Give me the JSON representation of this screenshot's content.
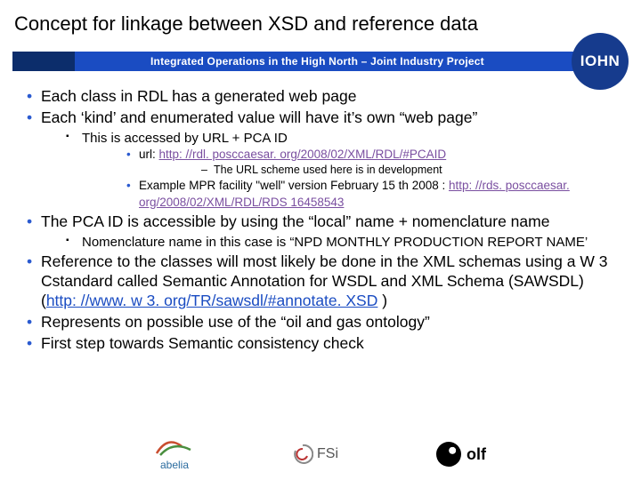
{
  "title": "Concept for linkage between XSD and reference data",
  "banner": {
    "text": "Integrated Operations in the High North – Joint Industry Project",
    "logo": "IOHN"
  },
  "bullets": {
    "b1": "Each class in RDL has a generated web page",
    "b2": "Each ‘kind’ and enumerated value will have it’s own “web page”",
    "b2_1": "This is accessed by URL + PCA ID",
    "b2_1_1_pre": "url: ",
    "b2_1_1_link": "http: //rdl. posccaesar. org/2008/02/XML/RDL/#PCAID",
    "b2_1_1_1": "The URL scheme used here is in development",
    "b2_1_2_pre": "Example MPR facility \"well\" version February 15 th 2008 : ",
    "b2_1_2_link": "http: //rds. posccaesar. org/2008/02/XML/RDL/RDS 16458543",
    "b3": "The PCA ID is accessible by using the “local” name + nomenclature name",
    "b3_1": "Nomenclature name in this case is “NPD MONTHLY PRODUCTION REPORT NAME’",
    "b4_pre": "Reference to the classes will most likely be done in the XML schemas using a W 3 Cstandard called Semantic Annotation for WSDL and XML Schema (SAWSDL) (",
    "b4_link": "http: //www. w 3. org/TR/sawsdl/#annotate. XSD",
    "b4_post": " )",
    "b5": "Represents on possible use of the “oil and gas ontology”",
    "b6": "First step towards Semantic consistency check"
  },
  "logos": {
    "abelia": "abelia",
    "fsi": "FSi",
    "olf": "olf"
  }
}
